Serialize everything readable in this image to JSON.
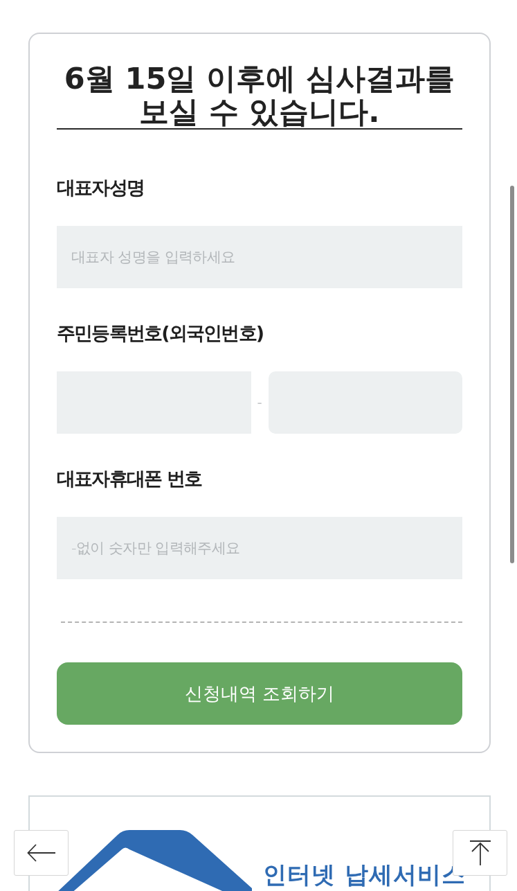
{
  "title": "6월 15일 이후에 심사결과를 보실 수 있습니다.",
  "fields": [
    {
      "kind": "text",
      "label": "대표자성명",
      "placeholder": "대표자 성명을 입력하세요"
    },
    {
      "kind": "split",
      "label": "주민등록번호(외국인번호)",
      "separator": "-"
    },
    {
      "kind": "text",
      "label": "대표자휴대폰 번호",
      "placeholder": "-없이 숫자만 입력해주세요"
    }
  ],
  "submit_button": "신청내역 조회하기",
  "banner": {
    "logo_text": "인터넷 납세서비스"
  }
}
